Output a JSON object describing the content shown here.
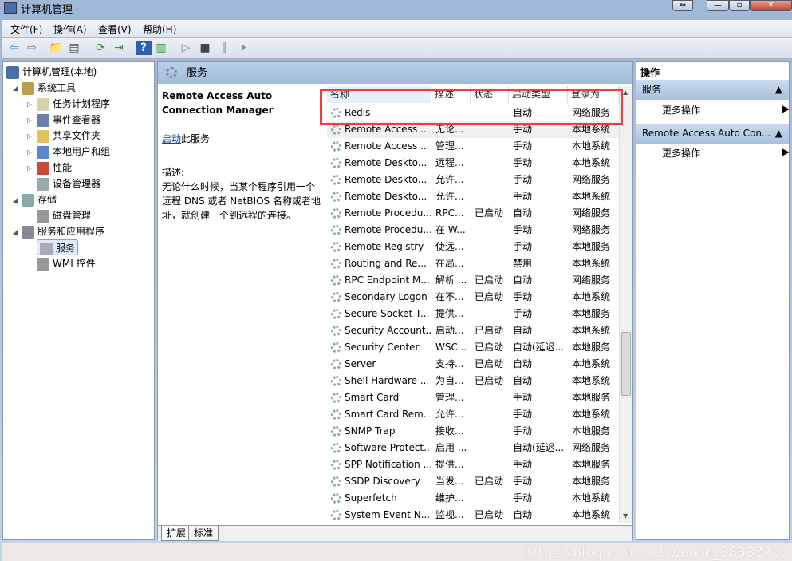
{
  "window": {
    "title": "计算机管理",
    "buttons": [
      "⇔",
      "—",
      "▫",
      "✕"
    ]
  },
  "menu": [
    "文件(F)",
    "操作(A)",
    "查看(V)",
    "帮助(H)"
  ],
  "toolbar": [
    {
      "icon": "back-arrow-icon",
      "g": "⇦",
      "c": "#2a8ad8"
    },
    {
      "icon": "forward-arrow-icon",
      "g": "⇨",
      "c": "#777"
    },
    {
      "icon": "up-folder-icon",
      "g": "📁",
      "c": "#c90"
    },
    {
      "icon": "show-tree-icon",
      "g": "▤",
      "c": "#555"
    },
    {
      "icon": "refresh-icon",
      "g": "⟳",
      "c": "#393"
    },
    {
      "icon": "export-list-icon",
      "g": "⇥",
      "c": "#393"
    },
    {
      "icon": "help-icon",
      "g": "?",
      "c": "#fff"
    },
    {
      "icon": "show-action-pane-icon",
      "g": "▥",
      "c": "#393"
    },
    {
      "icon": "play-icon",
      "g": "▷",
      "c": "#888"
    },
    {
      "icon": "stop-icon",
      "g": "■",
      "c": "#444"
    },
    {
      "icon": "pause-icon",
      "g": "‖",
      "c": "#888"
    },
    {
      "icon": "restart-icon",
      "g": "⏵",
      "c": "#888"
    }
  ],
  "tree": [
    {
      "label": "计算机管理(本地)",
      "level": 0,
      "arrow": "",
      "color": "#4a6fa5"
    },
    {
      "label": "系统工具",
      "level": 1,
      "arrow": "◢",
      "color": "#b8a050"
    },
    {
      "label": "任务计划程序",
      "level": 2,
      "arrow": "▷",
      "color": "#d9d2b0"
    },
    {
      "label": "事件查看器",
      "level": 2,
      "arrow": "▷",
      "color": "#6b7fb0"
    },
    {
      "label": "共享文件夹",
      "level": 2,
      "arrow": "▷",
      "color": "#e2c25a"
    },
    {
      "label": "本地用户和组",
      "level": 2,
      "arrow": "▷",
      "color": "#5a88c8"
    },
    {
      "label": "性能",
      "level": 2,
      "arrow": "▷",
      "color": "#c84a3a"
    },
    {
      "label": "设备管理器",
      "level": 2,
      "arrow": "",
      "color": "#9aa"
    },
    {
      "label": "存储",
      "level": 1,
      "arrow": "◢",
      "color": "#8aa"
    },
    {
      "label": "磁盘管理",
      "level": 2,
      "arrow": "",
      "color": "#999"
    },
    {
      "label": "服务和应用程序",
      "level": 1,
      "arrow": "◢",
      "color": "#889"
    },
    {
      "label": "服务",
      "level": 2,
      "arrow": "",
      "color": "#aab",
      "selected": true
    },
    {
      "label": "WMI 控件",
      "level": 2,
      "arrow": "",
      "color": "#999"
    }
  ],
  "middle": {
    "header": "服务",
    "selected_title": "Remote Access Auto Connection Manager",
    "start_link": "启动",
    "start_suffix": "此服务",
    "desc_label": "描述:",
    "desc_text": "无论什么时候，当某个程序引用一个远程 DNS 或者 NetBIOS 名称或者地址，就创建一个到远程的连接。",
    "columns": [
      "名称",
      "描述",
      "状态",
      "启动类型",
      "登录为"
    ],
    "rows": [
      [
        "Redis",
        "",
        "",
        "自动",
        "网络服务"
      ],
      [
        "Remote Access ...",
        "无论...",
        "",
        "手动",
        "本地系统"
      ],
      [
        "Remote Access ...",
        "管理...",
        "",
        "手动",
        "本地系统"
      ],
      [
        "Remote Deskto...",
        "远程...",
        "",
        "手动",
        "本地系统"
      ],
      [
        "Remote Deskto...",
        "允许...",
        "",
        "手动",
        "网络服务"
      ],
      [
        "Remote Deskto...",
        "允许...",
        "",
        "手动",
        "本地系统"
      ],
      [
        "Remote Procedu...",
        "RPC...",
        "已启动",
        "自动",
        "网络服务"
      ],
      [
        "Remote Procedu...",
        "在 W...",
        "",
        "手动",
        "网络服务"
      ],
      [
        "Remote Registry",
        "使远...",
        "",
        "手动",
        "本地服务"
      ],
      [
        "Routing and Re...",
        "在局...",
        "",
        "禁用",
        "本地系统"
      ],
      [
        "RPC Endpoint M...",
        "解析 ...",
        "已启动",
        "自动",
        "网络服务"
      ],
      [
        "Secondary Logon",
        "在不...",
        "已启动",
        "手动",
        "本地系统"
      ],
      [
        "Secure Socket T...",
        "提供...",
        "",
        "手动",
        "本地服务"
      ],
      [
        "Security Account...",
        "启动...",
        "已启动",
        "自动",
        "本地系统"
      ],
      [
        "Security Center",
        "WSC...",
        "已启动",
        "自动(延迟...",
        "本地服务"
      ],
      [
        "Server",
        "支持...",
        "已启动",
        "自动",
        "本地系统"
      ],
      [
        "Shell Hardware ...",
        "为自...",
        "已启动",
        "自动",
        "本地系统"
      ],
      [
        "Smart Card",
        "管理...",
        "",
        "手动",
        "本地服务"
      ],
      [
        "Smart Card Rem...",
        "允许...",
        "",
        "手动",
        "本地系统"
      ],
      [
        "SNMP Trap",
        "接收...",
        "",
        "手动",
        "本地服务"
      ],
      [
        "Software Protect...",
        "启用 ...",
        "",
        "自动(延迟...",
        "网络服务"
      ],
      [
        "SPP Notification ...",
        "提供...",
        "",
        "手动",
        "本地服务"
      ],
      [
        "SSDP Discovery",
        "当发...",
        "已启动",
        "手动",
        "本地服务"
      ],
      [
        "Superfetch",
        "维护...",
        "",
        "手动",
        "本地系统"
      ],
      [
        "System Event N...",
        "监视...",
        "已启动",
        "自动",
        "本地系统"
      ]
    ],
    "tabs": [
      "扩展",
      "标准"
    ],
    "highlight_color": "#f03c3c"
  },
  "actions": {
    "title": "操作",
    "sections": [
      {
        "label": "服务",
        "item": "更多操作"
      },
      {
        "label": "Remote Access Auto Con...",
        "item": "更多操作"
      }
    ]
  },
  "status": {
    "watermark": "https://blog.csdn.net/weixin_38887752"
  }
}
